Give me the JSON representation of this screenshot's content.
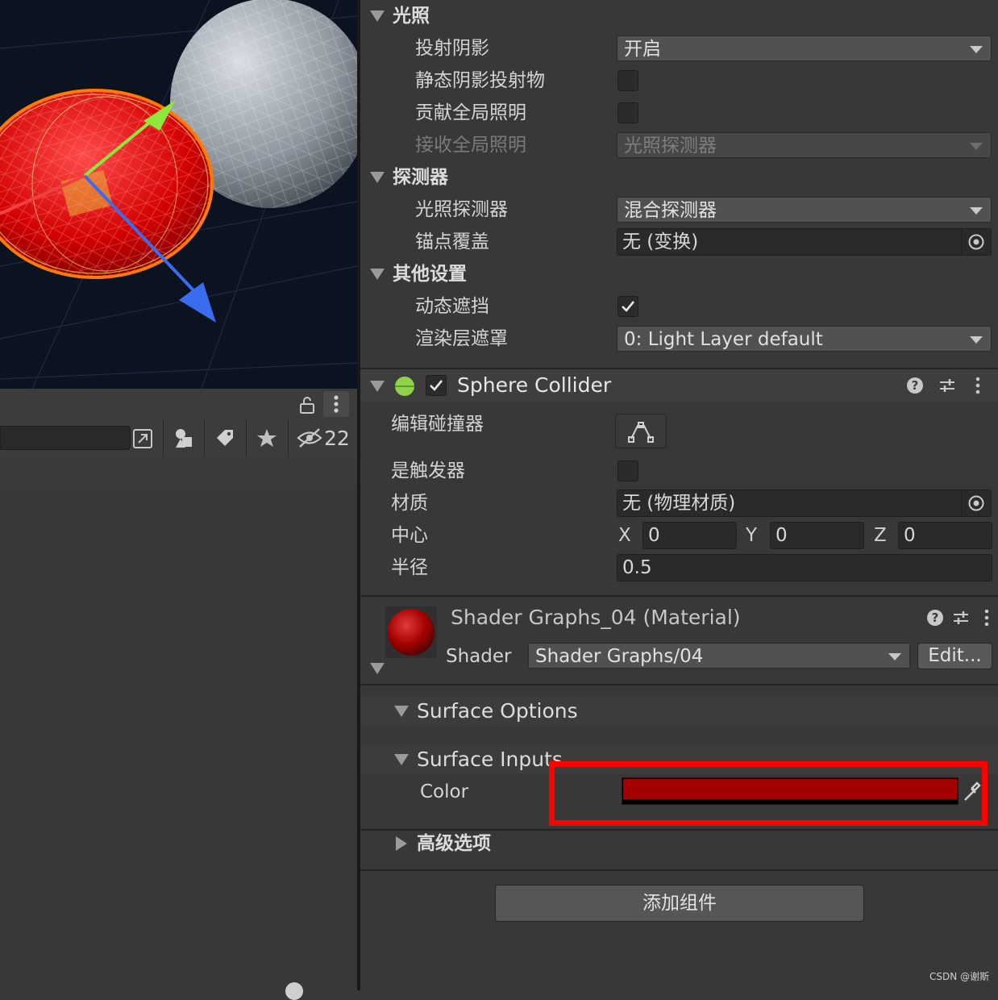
{
  "inspector": {
    "lighting": {
      "title": "光照",
      "cast_shadows_label": "投射阴影",
      "cast_shadows_value": "开启",
      "static_shadow_caster_label": "静态阴影投射物",
      "contribute_gi_label": "贡献全局照明",
      "receive_gi_label": "接收全局照明",
      "receive_gi_value": "光照探测器"
    },
    "probes": {
      "title": "探测器",
      "light_probes_label": "光照探测器",
      "light_probes_value": "混合探测器",
      "anchor_override_label": "锚点覆盖",
      "anchor_override_value": "无 (变换)"
    },
    "other": {
      "title": "其他设置",
      "dynamic_occlusion_label": "动态遮挡",
      "dynamic_occlusion_checked": true,
      "rendering_layer_label": "渲染层遮罩",
      "rendering_layer_value": "0: Light Layer default"
    },
    "sphere_collider": {
      "title": "Sphere Collider",
      "enabled": true,
      "edit_collider_label": "编辑碰撞器",
      "is_trigger_label": "是触发器",
      "material_label": "材质",
      "material_value": "无 (物理材质)",
      "center_label": "中心",
      "center": {
        "x_label": "X",
        "x": "0",
        "y_label": "Y",
        "y": "0",
        "z_label": "Z",
        "z": "0"
      },
      "radius_label": "半径",
      "radius_value": "0.5"
    },
    "material": {
      "name": "Shader Graphs_04 (Material)",
      "shader_label": "Shader",
      "shader_value": "Shader Graphs/04",
      "edit_label": "Edit...",
      "surface_options_label": "Surface Options",
      "surface_inputs_label": "Surface Inputs",
      "color_label": "Color",
      "color_value": "#a30000",
      "advanced_label": "高级选项"
    },
    "add_component_label": "添加组件"
  },
  "left_panel": {
    "hidden_count": "22"
  },
  "watermark": "CSDN @谢斯",
  "colors": {
    "highlight_box": "#ff0000",
    "selection_outline": "#ff7a00"
  }
}
